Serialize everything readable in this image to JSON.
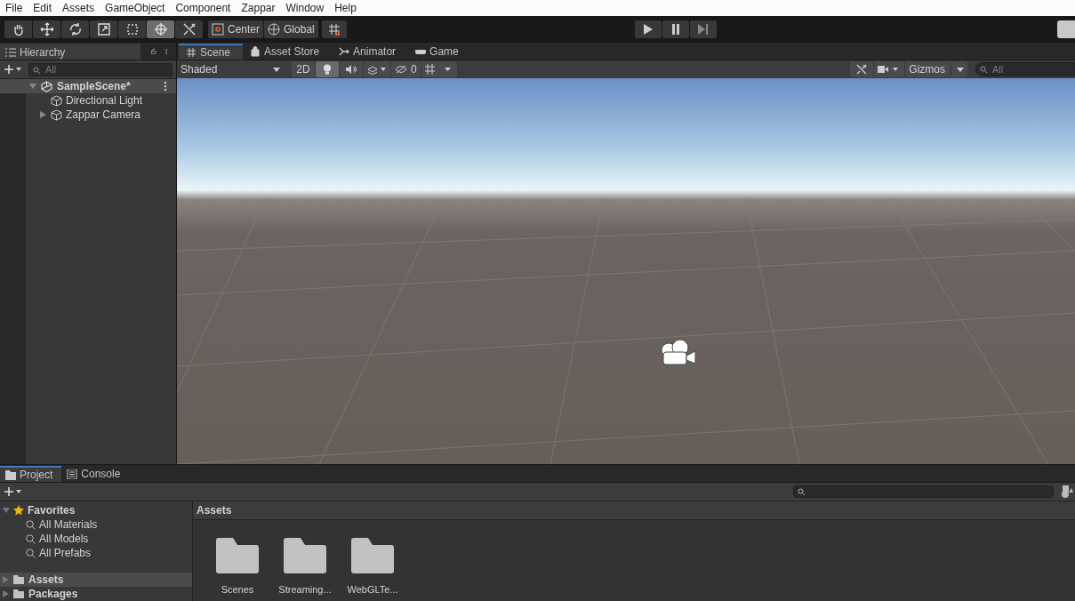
{
  "menu": [
    "File",
    "Edit",
    "Assets",
    "GameObject",
    "Component",
    "Zappar",
    "Window",
    "Help"
  ],
  "tools": [
    {
      "kind": "hand",
      "selected": false
    },
    {
      "kind": "move",
      "selected": false
    },
    {
      "kind": "rotate",
      "selected": false
    },
    {
      "kind": "scale",
      "selected": false
    },
    {
      "kind": "rect",
      "selected": false
    },
    {
      "kind": "transform",
      "selected": true
    },
    {
      "kind": "custom",
      "selected": false
    }
  ],
  "pivot": {
    "position": "Center",
    "rotation": "Global"
  },
  "hierarchy": {
    "title": "Hierarchy",
    "search_placeholder": "All",
    "scene": {
      "name": "SampleScene*",
      "expanded": true,
      "children": [
        {
          "name": "Directional Light"
        },
        {
          "name": "Zappar Camera",
          "expanded": false
        }
      ]
    }
  },
  "scene_tabs": [
    {
      "label": "Scene",
      "kind": "scene",
      "selected": true
    },
    {
      "label": "Asset Store",
      "kind": "store",
      "selected": false
    },
    {
      "label": "Animator",
      "kind": "animator",
      "selected": false
    },
    {
      "label": "Game",
      "kind": "game",
      "selected": false
    }
  ],
  "scene_toolbar": {
    "draw_mode": "Shaded",
    "mode_2d": "2D",
    "hidden_count": "0",
    "gizmos": "Gizmos",
    "search_placeholder": "All"
  },
  "bottom_tabs": [
    {
      "label": "Project",
      "kind": "project",
      "selected": true
    },
    {
      "label": "Console",
      "kind": "console",
      "selected": false
    }
  ],
  "favorites": {
    "label": "Favorites",
    "expanded": true,
    "items": [
      "All Materials",
      "All Models",
      "All Prefabs"
    ]
  },
  "roots": [
    {
      "label": "Assets",
      "selected": true
    },
    {
      "label": "Packages",
      "selected": false
    }
  ],
  "assets": {
    "title": "Assets",
    "folders": [
      "Scenes",
      "Streaming...",
      "WebGLTe..."
    ]
  }
}
